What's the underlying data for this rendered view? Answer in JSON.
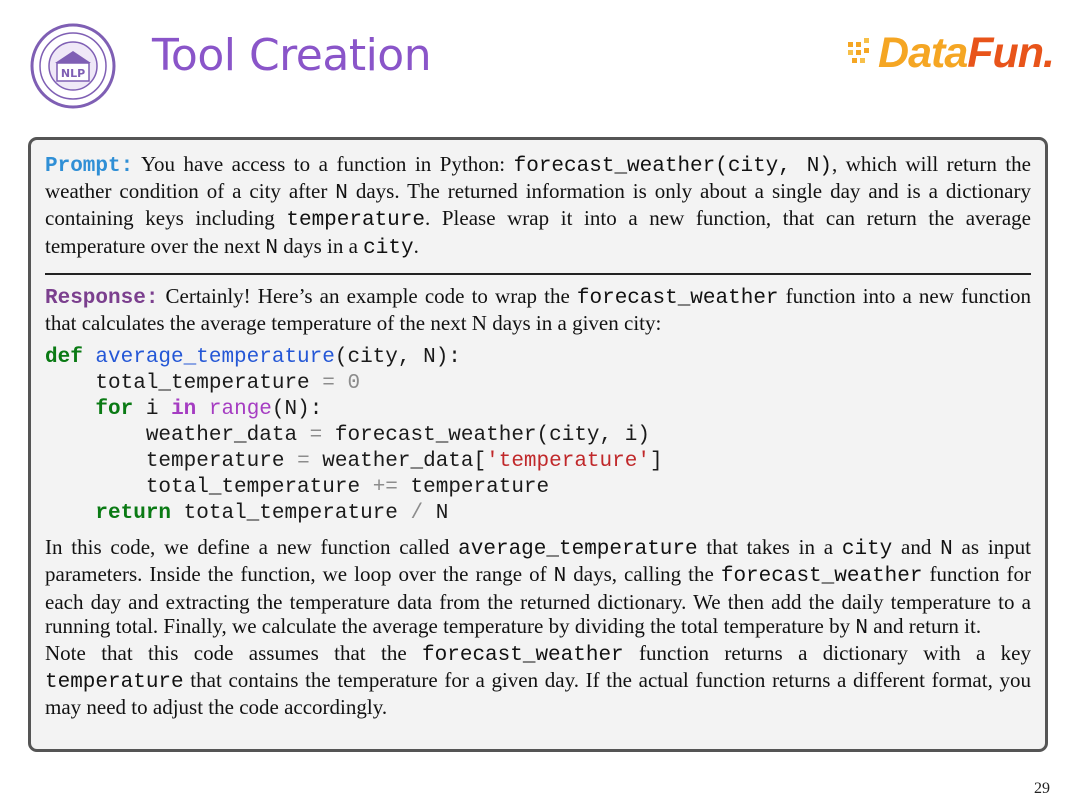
{
  "header": {
    "title": "Tool Creation",
    "brand": {
      "part1": "Data",
      "part2": "Fun."
    },
    "logo_label": "NLP"
  },
  "prompt": {
    "label": "Prompt:",
    "t1": "You have access to a function in Python: ",
    "c1": "forecast_weather(city, N)",
    "t2": ", which will return the weather condition of a city after ",
    "c2": "N",
    "t3": " days. The returned information is only about a single day and is a dictionary containing keys including ",
    "c3": "temperature",
    "t4": ". Please wrap it into a new function, that can return the average temperature over the next ",
    "c4": "N",
    "t5": " days in a ",
    "c5": "city",
    "t6": "."
  },
  "response": {
    "label": "Response:",
    "t1": "Certainly! Here’s an example code to wrap the ",
    "c1": "forecast_weather",
    "t2": " function into a new function that calculates the average temperature of the next N days in a given city:"
  },
  "code": {
    "l1_kw": "def",
    "l1_fn": "average_temperature",
    "l1_rest": "(city, N):",
    "l2_a": "total_temperature",
    "l2_op": "=",
    "l2_num": "0",
    "l3_kw1": "for",
    "l3_var": "i",
    "l3_kw2": "in",
    "l3_bi": "range",
    "l3_rest": "(N):",
    "l4_a": "weather_data",
    "l4_op": "=",
    "l4_rest": "forecast_weather(city, i)",
    "l5_a": "temperature",
    "l5_op": "=",
    "l5_b": "weather_data[",
    "l5_str": "'temperature'",
    "l5_c": "]",
    "l6_a": "total_temperature",
    "l6_op": "+=",
    "l6_b": "temperature",
    "l7_kw": "return",
    "l7_a": "total_temperature",
    "l7_op": "/",
    "l7_b": "N"
  },
  "explanation": {
    "t1": "In this code, we define a new function called ",
    "c1": "average_temperature",
    "t2": " that takes in a ",
    "c2": "city",
    "t3": " and ",
    "c3": "N",
    "t4": " as input parameters. Inside the function, we loop over the range of ",
    "c4": "N",
    "t5": " days, calling the ",
    "c5": "forecast_weather",
    "t6": " function for each day and extracting the temperature data from the returned dictionary. We then add the daily temperature to a running total. Finally, we calculate the average temperature by dividing the total temperature by ",
    "c6": "N",
    "t7": " and return it."
  },
  "note": {
    "t1": "Note that this code assumes that the ",
    "c1": "forecast_weather",
    "t2": " function returns a dictionary with a key ",
    "c2": "temperature",
    "t3": " that contains the temperature for a given day. If the actual function returns a different format, you may need to adjust the code accordingly."
  },
  "page_number": "29"
}
